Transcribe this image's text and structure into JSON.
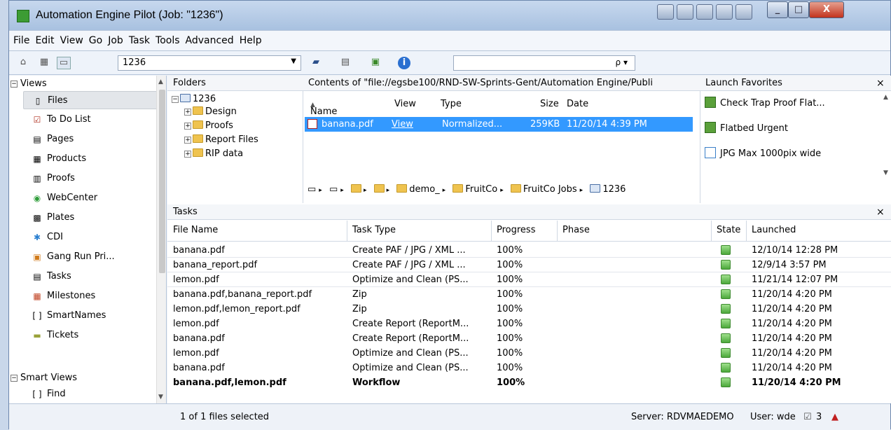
{
  "window": {
    "title": "Automation Engine Pilot (Job: \"1236\")",
    "close_glyph": "X",
    "min_glyph": "_",
    "max_glyph": "□"
  },
  "menu": [
    "File",
    "Edit",
    "View",
    "Go",
    "Job",
    "Task",
    "Tools",
    "Advanced",
    "Help"
  ],
  "toolbar": {
    "job_value": "1236",
    "search_value": "",
    "search_icon": "ρ ▾"
  },
  "left_panel": {
    "views_header": "Views",
    "items": [
      "Files",
      "To Do List",
      "Pages",
      "Products",
      "Proofs",
      "WebCenter",
      "Plates",
      "CDI",
      "Gang Run Pri...",
      "Tasks",
      "Milestones",
      "SmartNames",
      "Tickets"
    ],
    "smart_views_header": "Smart Views",
    "smart_items": [
      "Find"
    ],
    "active_item": "Files"
  },
  "folders": {
    "header": "Folders",
    "root": "1236",
    "children": [
      "Design",
      "Proofs",
      "Report Files",
      "RIP data"
    ]
  },
  "contents": {
    "header": "Contents of \"file://egsbe100/RND-SW-Sprints-Gent/Automation Engine/Publi",
    "columns": {
      "name": "Name",
      "sort": "▲",
      "view": "View",
      "type": "Type",
      "size": "Size",
      "date": "Date"
    },
    "row": {
      "name": "banana.pdf",
      "view": "View",
      "type": "Normalized...",
      "size": "259KB",
      "date": "11/20/14 4:39 PM"
    },
    "breadcrumb": [
      "demo_",
      "FruitCo",
      "FruitCo Jobs",
      "1236"
    ]
  },
  "favorites": {
    "header": "Launch Favorites",
    "close_label": "×",
    "items": [
      "Check Trap Proof Flat...",
      "Flatbed Urgent",
      "JPG Max 1000pix wide"
    ]
  },
  "tasks": {
    "header": "Tasks",
    "close_label": "×",
    "columns": {
      "file": "File Name",
      "type": "Task Type",
      "progress": "Progress",
      "phase": "Phase",
      "state": "State",
      "launched": "Launched"
    },
    "rows": [
      {
        "file": "banana.pdf",
        "type": "Create PAF / JPG / XML ...",
        "progress": "100%",
        "launched": "12/10/14 12:28 PM"
      },
      {
        "file": "banana_report.pdf",
        "type": "Create PAF / JPG / XML ...",
        "progress": "100%",
        "launched": "12/9/14 3:57 PM"
      },
      {
        "file": "lemon.pdf",
        "type": "Optimize and Clean (PS...",
        "progress": "100%",
        "launched": "11/21/14 12:07 PM"
      },
      {
        "file": "banana.pdf,banana_report.pdf",
        "type": "Zip",
        "progress": "100%",
        "launched": "11/20/14 4:20 PM"
      },
      {
        "file": "lemon.pdf,lemon_report.pdf",
        "type": "Zip",
        "progress": "100%",
        "launched": "11/20/14 4:20 PM"
      },
      {
        "file": "lemon.pdf",
        "type": "Create Report (ReportM...",
        "progress": "100%",
        "launched": "11/20/14 4:20 PM"
      },
      {
        "file": "banana.pdf",
        "type": "Create Report (ReportM...",
        "progress": "100%",
        "launched": "11/20/14 4:20 PM"
      },
      {
        "file": "lemon.pdf",
        "type": "Optimize and Clean (PS...",
        "progress": "100%",
        "launched": "11/20/14 4:20 PM"
      },
      {
        "file": "banana.pdf",
        "type": "Optimize and Clean (PS...",
        "progress": "100%",
        "launched": "11/20/14 4:20 PM"
      },
      {
        "file": "banana.pdf,lemon.pdf",
        "type": "Workflow",
        "progress": "100%",
        "launched": "11/20/14 4:20 PM"
      }
    ]
  },
  "status": {
    "selection": "1 of 1 files selected",
    "server": "Server: RDVMAEDEMO",
    "user": "User: wde",
    "count": "3"
  }
}
